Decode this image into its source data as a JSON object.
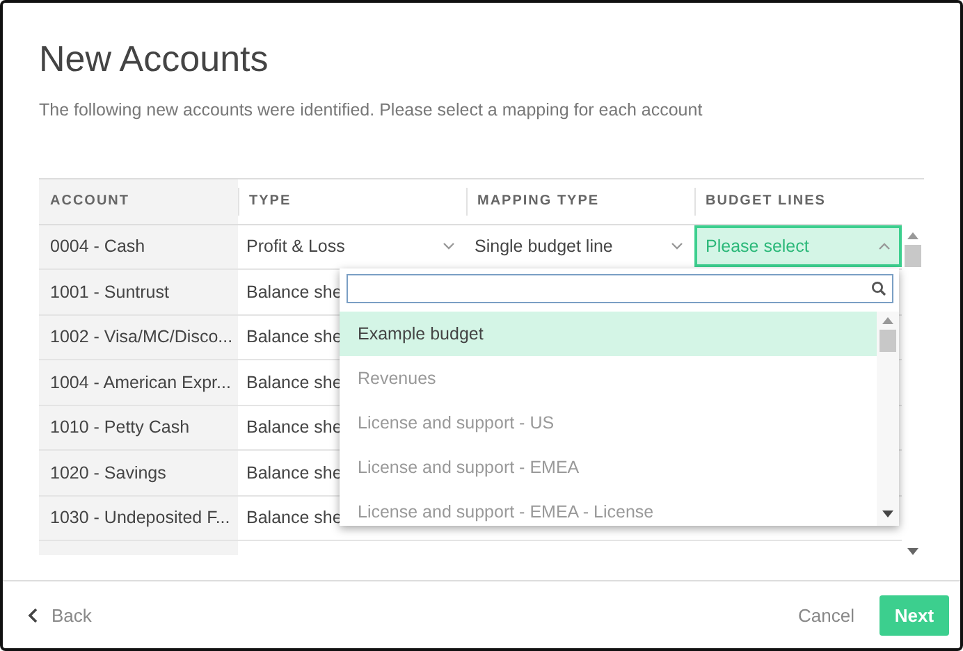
{
  "title": "New Accounts",
  "subtitle": "The following new accounts were identified. Please select a mapping for each account",
  "table": {
    "columns": [
      "ACCOUNT",
      "TYPE",
      "MAPPING TYPE",
      "BUDGET LINES"
    ],
    "rows": [
      {
        "account": "0004 - Cash",
        "type": "Profit & Loss",
        "mapping_type": "Single budget line",
        "budget_line": {
          "text": "Please select",
          "open": true
        }
      },
      {
        "account": "1001 - Suntrust",
        "type": "Balance she"
      },
      {
        "account": "1002 - Visa/MC/Disco...",
        "type": "Balance she"
      },
      {
        "account": "1004 - American Expr...",
        "type": "Balance she"
      },
      {
        "account": "1010 - Petty Cash",
        "type": "Balance she"
      },
      {
        "account": "1020 - Savings",
        "type": "Balance she"
      },
      {
        "account": "1030 - Undeposited F...",
        "type": "Balance she"
      }
    ]
  },
  "dropdown": {
    "items": [
      {
        "label": "Example budget",
        "selected": true
      },
      {
        "label": "Revenues",
        "selected": false
      },
      {
        "label": "License and support - US",
        "selected": false
      },
      {
        "label": "License and support - EMEA",
        "selected": false
      },
      {
        "label": "License and support - EMEA - License",
        "selected": false
      }
    ]
  },
  "footer": {
    "back": "Back",
    "cancel": "Cancel",
    "next": "Next"
  }
}
